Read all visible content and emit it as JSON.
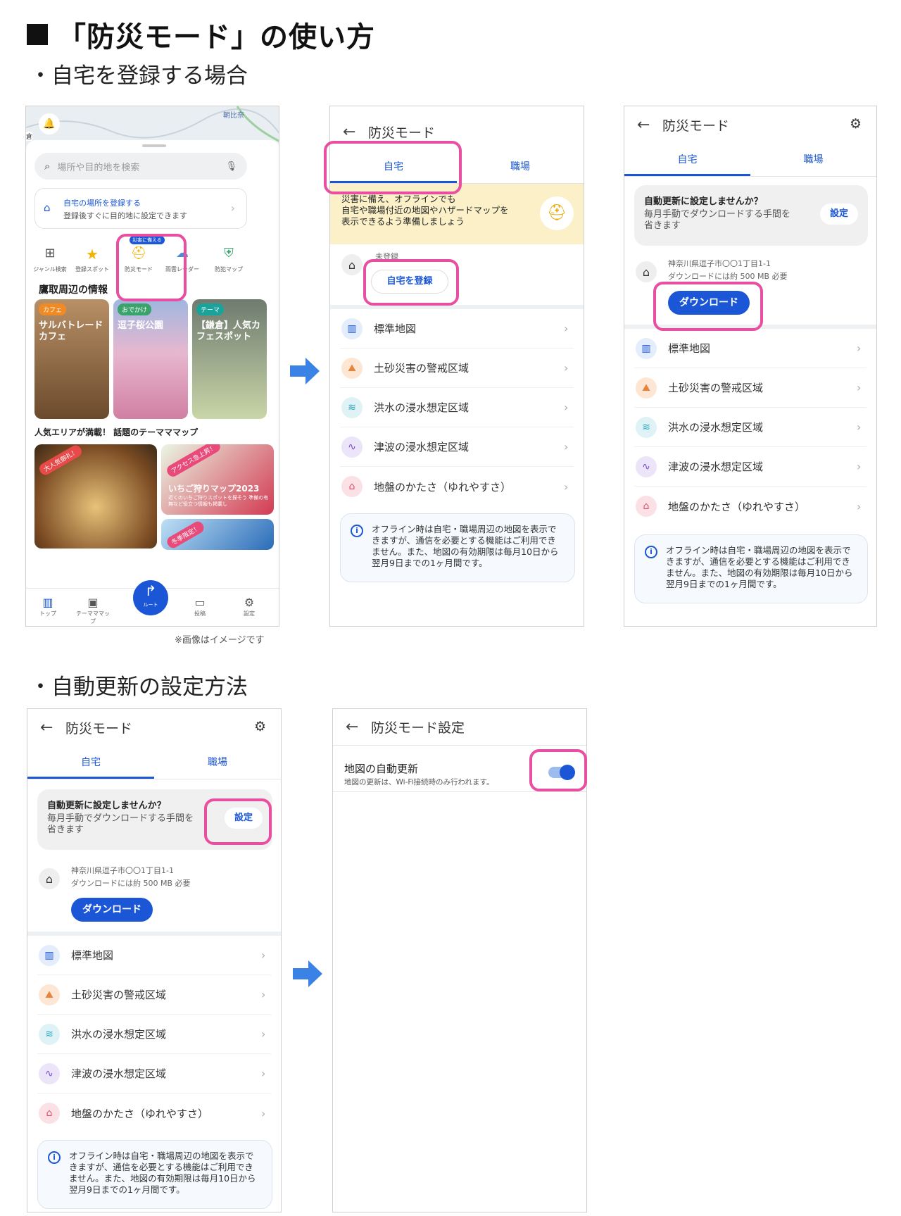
{
  "page_title": "「防災モード」の使い方",
  "section1": "・自宅を登録する場合",
  "section2": "・自動更新の設定方法",
  "image_note": "※画像はイメージです",
  "home_screen": {
    "map_label": "朝比奈",
    "map_left_label": "倉",
    "search_placeholder": "場所や目的地を検索",
    "register_title": "自宅の場所を登録する",
    "register_sub": "登録後すぐに目的地に設定できます",
    "badge": "災害に備える",
    "quick_items": [
      "ジャンル検索",
      "登録スポット",
      "防災モード",
      "雨雲レーダー",
      "防犯マップ"
    ],
    "nearby_heading": "鷹取周辺の情報",
    "tiles": [
      {
        "tag": "カフェ",
        "title": "サルバトレードカフェ"
      },
      {
        "tag": "おでかけ",
        "title": "逗子桜公園"
      },
      {
        "tag": "テーマ",
        "title": "【鎌倉】人気カフェスポット"
      }
    ],
    "theme_heading": "人気エリアが満載！ 話題のテーマママップ",
    "banner1_tag": "大人気御礼！",
    "banner2_tag": "アクセス急上昇！",
    "banner2_title": "いちご狩りマップ2023",
    "banner2_sub": "近くのいちご狩りスポットを探そう 準備の有無など役立つ情報も掲載し",
    "banner3_tag": "冬季限定！",
    "nav": [
      "トップ",
      "テーマママップ",
      "ルート",
      "投稿",
      "設定"
    ]
  },
  "bosai": {
    "header": "防災モード",
    "tab_home": "自宅",
    "tab_work": "職場",
    "notice": "災害に備え、オフラインでも\n自宅や職場付近の地図やハザードマップを\n表示できるよう準備しましょう",
    "unregistered": "未登録",
    "register_button": "自宅を登録",
    "auto_title": "自動更新に設定しませんか？",
    "auto_sub": "毎月手動でダウンロードする手間を省きます",
    "auto_button": "設定",
    "address": "神奈川県逗子市〇〇1丁目1-1",
    "download_size": "ダウンロードには約 500 MB 必要",
    "download_button": "ダウンロード",
    "list": [
      "標準地図",
      "土砂災害の警戒区域",
      "洪水の浸水想定区域",
      "津波の浸水想定区域",
      "地盤のかたさ（ゆれやすさ）"
    ],
    "info": "オフライン時は自宅・職場周辺の地図を表示できますが、通信を必要とする機能はご利用できません。また、地図の有効期限は毎月10日から翌月9日までの1ヶ月間です。"
  },
  "settings": {
    "header": "防災モード設定",
    "toggle_title": "地図の自動更新",
    "toggle_sub": "地図の更新は、Wi-Fi接続時のみ行われます。",
    "toggle_on": true
  },
  "colors": {
    "accent": "#1a56d6",
    "highlight": "#e84fa0",
    "arrow": "#3b82e6"
  }
}
